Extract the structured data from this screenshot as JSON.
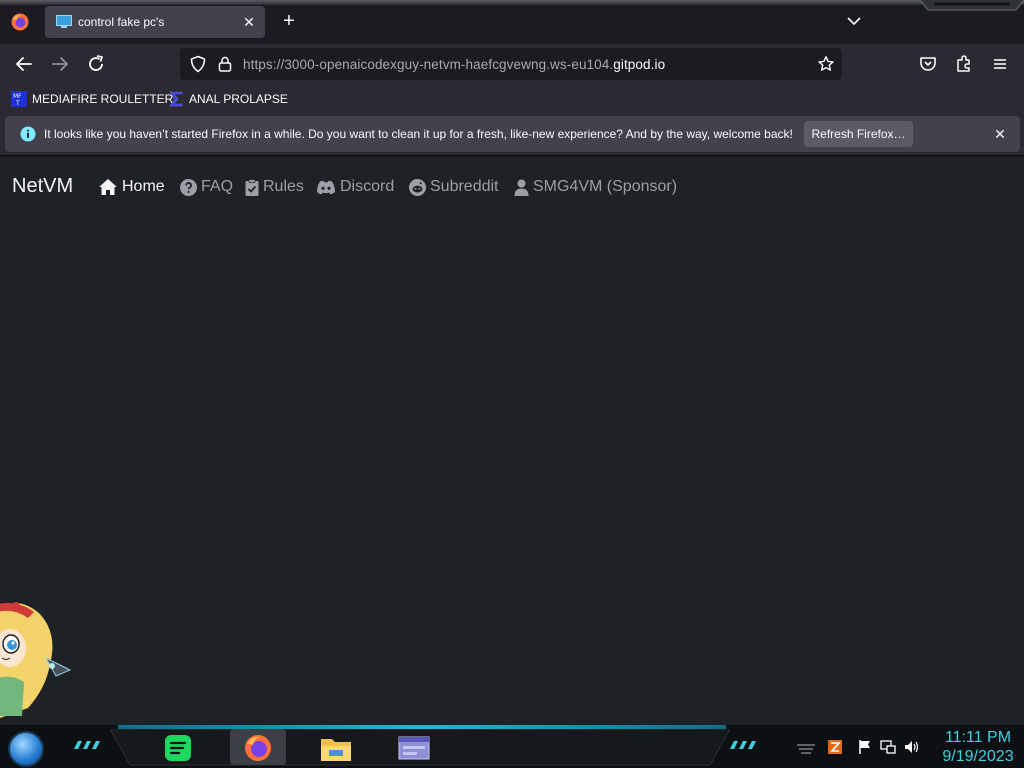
{
  "tabbar": {
    "tab_title": "control fake pc's",
    "tab_close": "✕",
    "new_tab": "+"
  },
  "navbar": {
    "url_prefix": "https://3000-openaicodexguy-netvm-haefcgvewng.ws-eu104.",
    "url_host": "gitpod.io"
  },
  "bookmarks": [
    {
      "label": "MEDIAFIRE ROULETTER"
    },
    {
      "label": "ANAL PROLAPSE"
    }
  ],
  "notification": {
    "message": "It looks like you haven’t started Firefox in a while. Do you want to clean it up for a fresh, like-new experience? And by the way, welcome back!",
    "button_label": "Refresh Firefox…",
    "close": "✕"
  },
  "site": {
    "brand": "NetVM",
    "nav": [
      {
        "label": "Home",
        "icon": "home-icon",
        "active": true
      },
      {
        "label": "FAQ",
        "icon": "question-circle-icon"
      },
      {
        "label": "Rules",
        "icon": "clipboard-check-icon"
      },
      {
        "label": "Discord",
        "icon": "discord-icon"
      },
      {
        "label": "Subreddit",
        "icon": "reddit-icon"
      },
      {
        "label": "SMG4VM (Sponsor)",
        "icon": "user-icon"
      }
    ]
  },
  "taskbar": {
    "time": "11:11 PM",
    "date": "9/19/2023",
    "apps": [
      "spotify-icon",
      "firefox-icon",
      "file-explorer-icon",
      "window-app-icon"
    ]
  },
  "colors": {
    "accent_cyan": "#3fd0e0",
    "page_bg": "#1e2125",
    "browser_chrome": "#2b2a33"
  }
}
